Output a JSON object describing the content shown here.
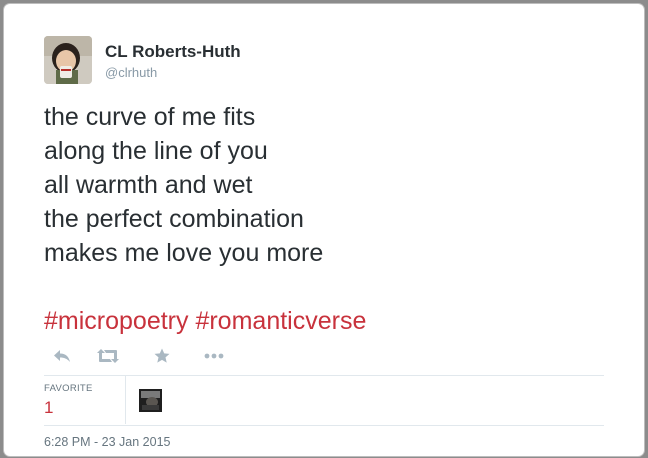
{
  "tweet": {
    "user": {
      "name": "CL Roberts-Huth",
      "handle": "@clrhuth"
    },
    "text_lines": [
      "the curve of me fits",
      "along the line of you",
      "all warmth and wet",
      "the perfect combination",
      "makes me love you more"
    ],
    "hashtags": [
      "#micropoetry",
      "#romanticverse"
    ],
    "actions": [
      "reply-icon",
      "retweet-icon",
      "favorite-icon",
      "more-icon"
    ],
    "stats": {
      "favorite_label": "FAVORITE",
      "favorite_count": "1"
    },
    "timestamp": "6:28 PM - 23 Jan 2015"
  },
  "colors": {
    "accent": "#c8323c",
    "text": "#292f33",
    "muted": "#8899a6",
    "icon": "#aab8c2",
    "border": "#e1e8ed"
  }
}
